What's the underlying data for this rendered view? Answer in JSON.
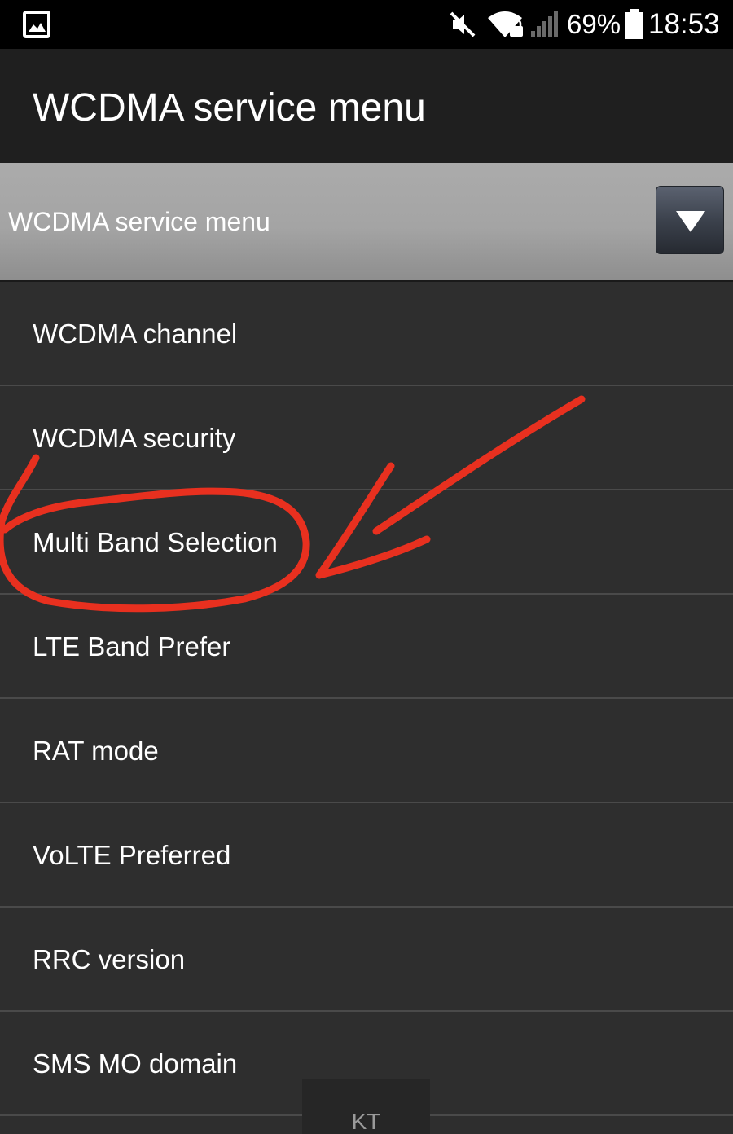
{
  "status_bar": {
    "battery_percent": "69%",
    "time": "18:53",
    "icons": [
      "gallery-icon",
      "mute-icon",
      "wifi-lock-icon",
      "signal-icon",
      "battery-icon"
    ]
  },
  "app_bar": {
    "title": "WCDMA service menu"
  },
  "spinner": {
    "selected": "WCDMA service menu",
    "icon": "chevron-down-icon"
  },
  "menu": {
    "items": [
      {
        "label": "WCDMA channel"
      },
      {
        "label": "WCDMA security"
      },
      {
        "label": "Multi Band Selection",
        "annotated": true
      },
      {
        "label": "LTE Band Prefer"
      },
      {
        "label": "RAT mode"
      },
      {
        "label": "VoLTE Preferred"
      },
      {
        "label": "RRC version"
      },
      {
        "label": "SMS MO domain"
      }
    ]
  },
  "annotation": {
    "color": "#e8301f",
    "shapes": [
      "circle-mark",
      "arrow-mark"
    ]
  },
  "toast": {
    "text": "KT"
  }
}
